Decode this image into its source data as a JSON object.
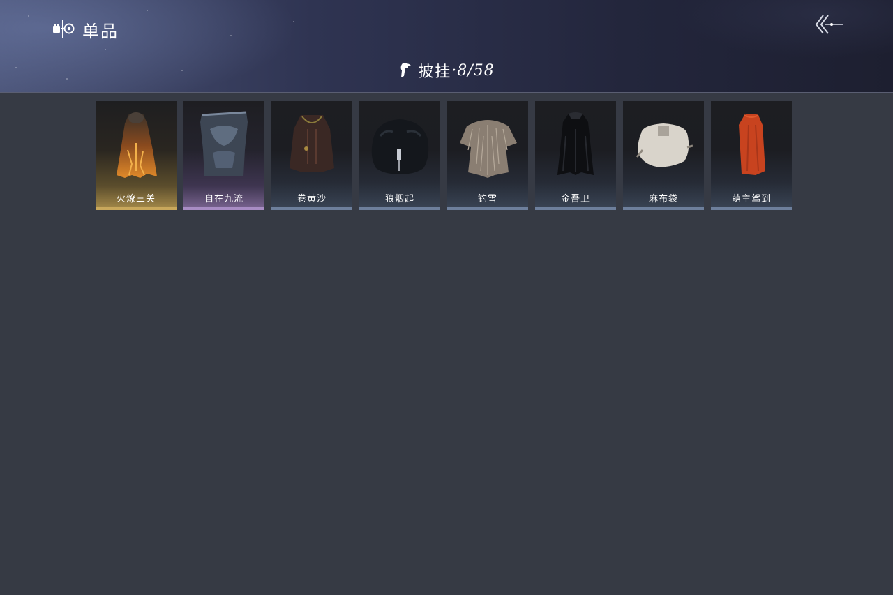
{
  "header": {
    "section_label": "单品",
    "section_icon": "cosmetics-icon",
    "back_icon": "back-arrow-icon",
    "category_icon": "cape-icon",
    "category_name": "披挂",
    "category_count": "·8/58"
  },
  "items": [
    {
      "name": "火燎三关",
      "rarity": "gold",
      "icon": "fire-cape-icon"
    },
    {
      "name": "自在九流",
      "rarity": "purple",
      "icon": "ornate-cape-icon"
    },
    {
      "name": "卷黄沙",
      "rarity": "blue",
      "icon": "dark-cloak-icon"
    },
    {
      "name": "狼烟起",
      "rarity": "blue",
      "icon": "fur-cape-icon"
    },
    {
      "name": "钓雪",
      "rarity": "blue",
      "icon": "straw-cape-icon"
    },
    {
      "name": "金吾卫",
      "rarity": "blue",
      "icon": "black-cloak-icon"
    },
    {
      "name": "麻布袋",
      "rarity": "blue",
      "icon": "sack-icon"
    },
    {
      "name": "萌主驾到",
      "rarity": "blue",
      "icon": "red-cape-icon"
    }
  ],
  "colors": {
    "background": "#363a44",
    "rarity_gold": "#c9a85c",
    "rarity_purple": "#a88cc4",
    "rarity_blue": "#6d7f9c"
  }
}
